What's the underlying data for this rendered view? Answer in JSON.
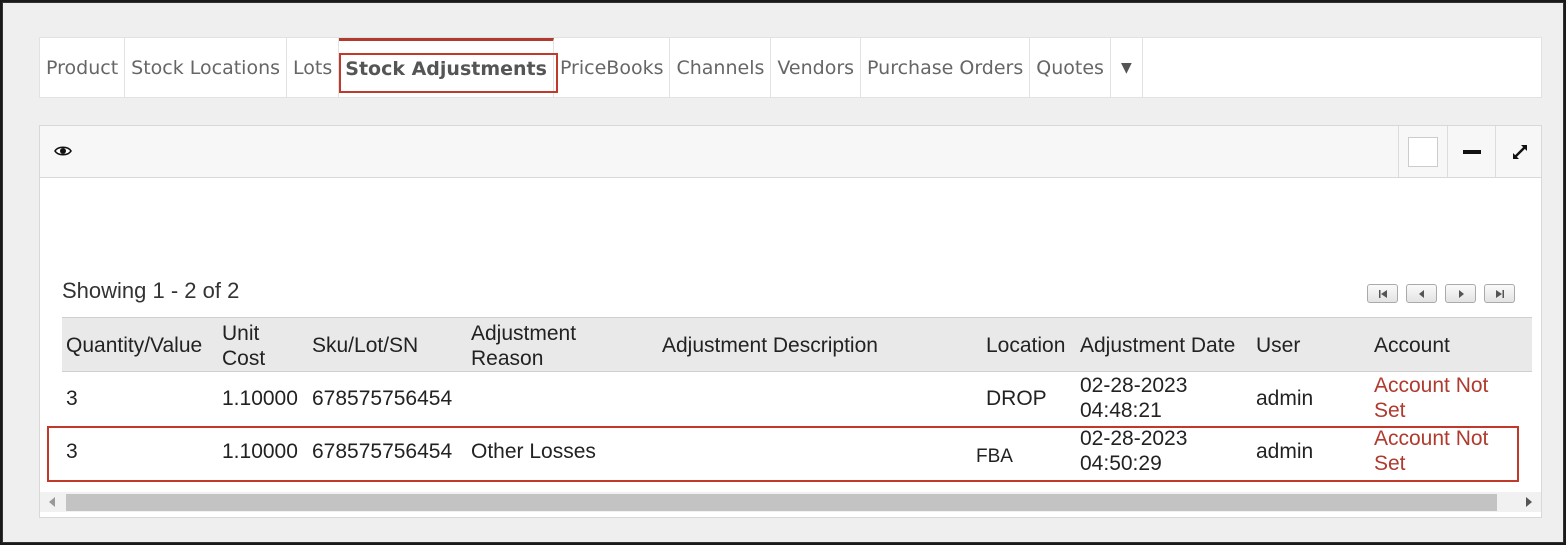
{
  "tabs": [
    {
      "label": "Product"
    },
    {
      "label": "Stock Locations"
    },
    {
      "label": "Lots"
    },
    {
      "label": "Stock Adjustments",
      "active": true
    },
    {
      "label": "PriceBooks"
    },
    {
      "label": "Channels"
    },
    {
      "label": "Vendors"
    },
    {
      "label": "Purchase Orders"
    },
    {
      "label": "Quotes"
    }
  ],
  "panel": {
    "showing_text": "Showing 1 - 2 of 2",
    "header_icons": [
      "eye-icon",
      "checkbox",
      "minimize-icon",
      "expand-icon"
    ],
    "pager_icons": [
      "first-page-icon",
      "prev-page-icon",
      "next-page-icon",
      "last-page-icon"
    ]
  },
  "table": {
    "headers": {
      "qty": "Quantity/Value",
      "unit_cost_1": "Unit",
      "unit_cost_2": "Cost",
      "sku": "Sku/Lot/SN",
      "reason_1": "Adjustment",
      "reason_2": "Reason",
      "description": "Adjustment Description",
      "location": "Location",
      "date": "Adjustment Date",
      "user": "User",
      "account": "Account"
    },
    "rows": [
      {
        "qty": "3",
        "unit_cost": "1.10000",
        "sku": "678575756454",
        "reason": "",
        "description": "",
        "location": "DROP",
        "date_1": "02-28-2023",
        "date_2": "04:48:21",
        "user": "admin",
        "account_1": "Account Not",
        "account_2": "Set"
      },
      {
        "qty": "3",
        "unit_cost": "1.10000",
        "sku": "678575756454",
        "reason": "Other Losses",
        "description": "",
        "location": "FBA",
        "date_1": "02-28-2023",
        "date_2": "04:50:29",
        "user": "admin",
        "account_1": "Account Not",
        "account_2": "Set"
      }
    ]
  },
  "colors": {
    "accent": "#b03a2e",
    "highlight": "#c0392b"
  }
}
